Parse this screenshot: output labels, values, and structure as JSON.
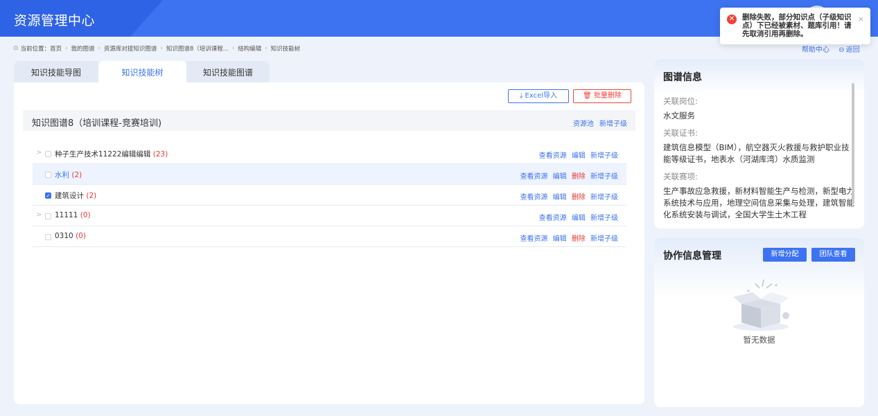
{
  "app": {
    "title": "资源管理中心"
  },
  "toast": {
    "message": "删除失败，部分知识点（子级知识点）下已经被素材、题库引用！请先取消引用再删除。",
    "close": "×"
  },
  "breadcrumb": {
    "prefix": "当前位置：",
    "items": [
      "首页",
      "我的图谱",
      "资源库对接知识图谱",
      "知识图谱8（培训课程...",
      "结构编辑",
      "知识技能树"
    ]
  },
  "toplinks": {
    "help": "帮助中心",
    "back": "返回"
  },
  "tabs": [
    "知识技能导图",
    "知识技能树",
    "知识技能图谱"
  ],
  "toolbar": {
    "import": "Excel导入",
    "batch_delete": "批量删除"
  },
  "graph": {
    "name": "知识图谱8（培训课程-竞赛培训)",
    "actions": [
      "资源池",
      "新增子级"
    ]
  },
  "rows": [
    {
      "name": "种子生产技术11222编辑编辑",
      "count": "(23)",
      "ops": [
        "查看资源",
        "编辑",
        "新增子级"
      ]
    },
    {
      "name": "水利",
      "count": "(2)",
      "ops": [
        "查看资源",
        "编辑",
        "删除",
        "新增子级"
      ]
    },
    {
      "name": "建筑设计",
      "count": "(2)",
      "ops": [
        "查看资源",
        "编辑",
        "删除",
        "新增子级"
      ]
    },
    {
      "name": "11111",
      "count": "(0)",
      "ops": [
        "查看资源",
        "编辑",
        "新增子级"
      ]
    },
    {
      "name": "0310",
      "count": "(0)",
      "ops": [
        "查看资源",
        "编辑",
        "删除",
        "新增子级"
      ]
    }
  ],
  "info": {
    "title": "图谱信息",
    "post_label": "关联岗位:",
    "post_value": "水文服务",
    "cert_label": "关联证书:",
    "cert_value": "建筑信息模型（BIM），航空器灭火救援与救护职业技能等级证书，地表水（河湖库湾）水质监测",
    "contest_label": "关联赛项:",
    "contest_value": "生产事故应急救援，新材料智能生产与检测，新型电力系统技术与应用，地理空间信息采集与处理，建筑智能化系统安装与调试，全国大学生土木工程"
  },
  "collab": {
    "title": "协作信息管理",
    "add": "新增分配",
    "team": "团队查看",
    "empty": "暂无数据"
  }
}
